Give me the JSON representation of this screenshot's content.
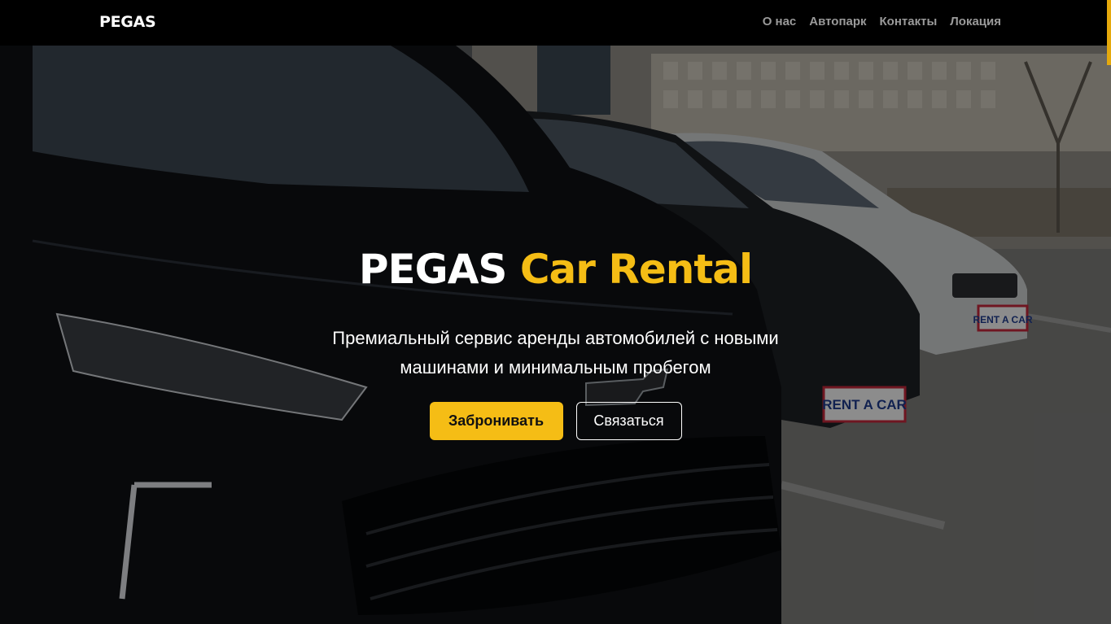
{
  "navbar": {
    "brand": "PEGAS",
    "links": [
      "О нас",
      "Автопарк",
      "Контакты",
      "Локация"
    ]
  },
  "hero": {
    "title_main": "PEGAS",
    "title_accent": "Car Rental",
    "subtitle": "Премиальный сервис аренды автомобилей с новыми машинами и минимальным пробегом",
    "primary_button": "Забронивать",
    "secondary_button": "Связаться",
    "plate_text": "RENT A CAR"
  },
  "colors": {
    "accent": "#f5bd15",
    "navbar_bg": "#000000",
    "nav_link": "#9a9a9a"
  }
}
